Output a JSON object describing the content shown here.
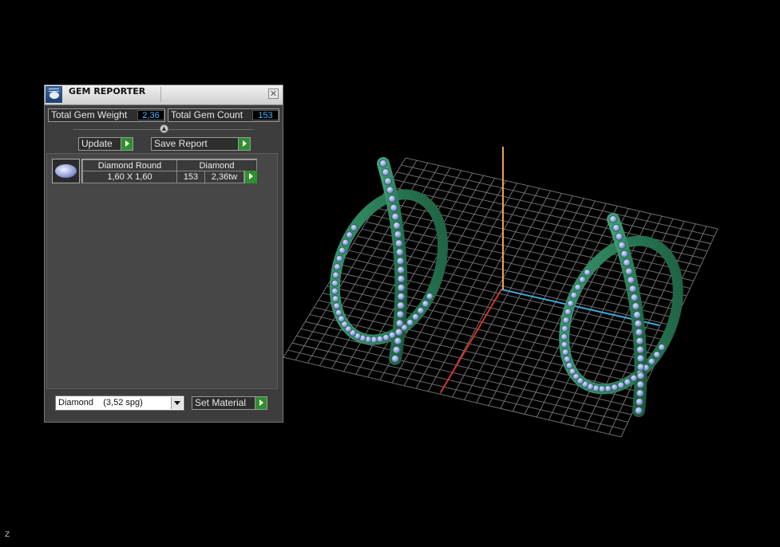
{
  "panel": {
    "title": "GEM REPORTER",
    "close_glyph": "✕",
    "app_icon": "gem-reporter-icon",
    "total_weight_label": "Total Gem Weight",
    "total_weight_value": "2,36",
    "total_count_label": "Total Gem Count",
    "total_count_value": "153",
    "collapse_glyph": "▲",
    "update_label": "Update",
    "save_report_label": "Save Report",
    "gem_rows": [
      {
        "shape": "Diamond Round",
        "size": "1,60 X 1,60",
        "material": "Diamond",
        "count": "153",
        "weight": "2,36tw"
      }
    ],
    "material_selected": "Diamond    (3,52 spg)",
    "set_material_label": "Set Material"
  },
  "viewport": {
    "axis_label": "Z",
    "grid_color": "#6e6e6e",
    "x_axis_color": "#d2352a",
    "y_axis_color": "#3fa8d8",
    "z_axis_color": "#e8a35a",
    "ring_color": "#2e8a62",
    "gem_color": "#8ea0e0"
  }
}
